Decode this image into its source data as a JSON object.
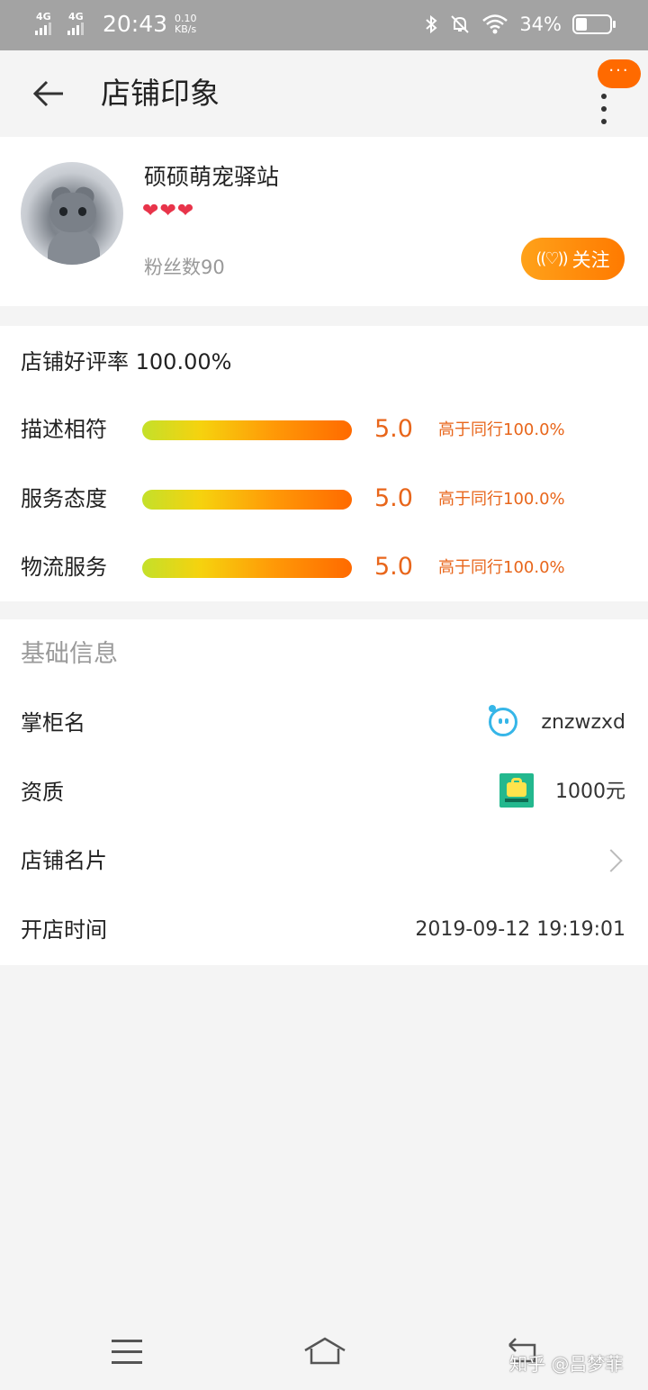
{
  "status_bar": {
    "net1": "4G",
    "net2": "4G",
    "time": "20:43",
    "speed_value": "0.10",
    "speed_unit": "KB/s",
    "battery_pct": "34%",
    "icons": [
      "signal-icon",
      "bluetooth-icon",
      "mute-bell-icon",
      "wifi-icon",
      "battery-icon"
    ]
  },
  "header": {
    "title": "店铺印象",
    "more_badge": "···"
  },
  "shop": {
    "name": "硕硕萌宠驿站",
    "hearts": [
      "❤",
      "❤",
      "❤"
    ],
    "fans_label": "粉丝数",
    "fans_count": "90",
    "follow_label": "关注",
    "follow_icon": "((♡))"
  },
  "rating": {
    "title": "店铺好评率",
    "rate": "100.00%",
    "rows": [
      {
        "label": "描述相符",
        "score": "5.0",
        "compare": "高于同行100.0%"
      },
      {
        "label": "服务态度",
        "score": "5.0",
        "compare": "高于同行100.0%"
      },
      {
        "label": "物流服务",
        "score": "5.0",
        "compare": "高于同行100.0%"
      }
    ]
  },
  "info": {
    "title": "基础信息",
    "keeper_label": "掌柜名",
    "keeper_value": "znzwzxd",
    "qual_label": "资质",
    "qual_value": "1000元",
    "card_label": "店铺名片",
    "open_label": "开店时间",
    "open_value": "2019-09-12 19:19:01"
  },
  "watermark": "知乎 @吕梦菲",
  "colors": {
    "accent": "#ff7a00",
    "score_text": "#e8661b",
    "keeper_icon": "#36b6e8",
    "qual_icon": "#23b88e"
  }
}
